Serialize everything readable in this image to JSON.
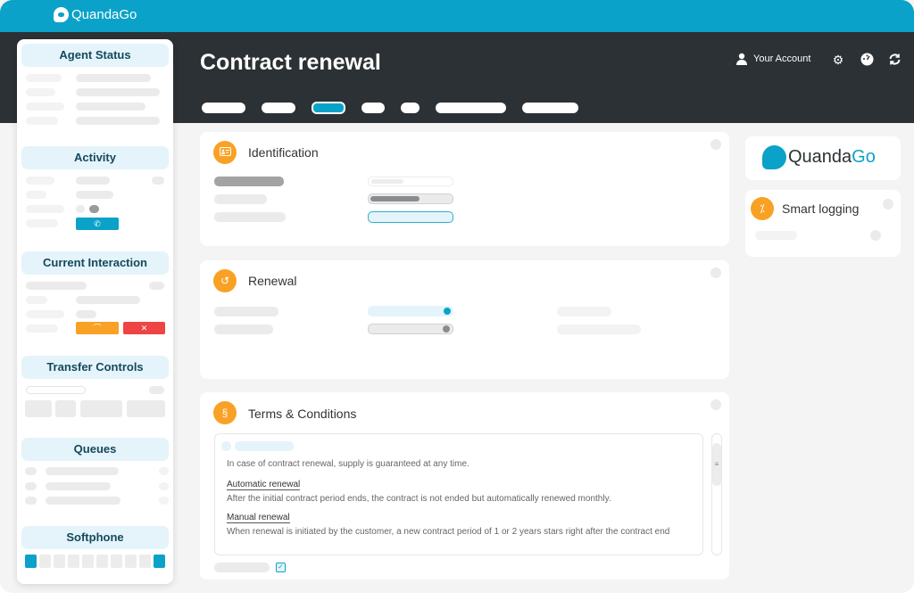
{
  "app": {
    "brand": "QuandaGo",
    "brand_part1": "Quanda",
    "brand_part2": "Go"
  },
  "header": {
    "title": "Contract renewal",
    "account_label": "Your Account",
    "tabs_count": 7,
    "active_tab_index": 2
  },
  "icons": {
    "account": "user-icon",
    "settings": "gear-icon",
    "dashboard": "gauge-icon",
    "refresh": "refresh-icon"
  },
  "sidebar": {
    "sections": [
      "Agent Status",
      "Activity",
      "Current Interaction",
      "Transfer Controls",
      "Queues",
      "Softphone"
    ],
    "activity_button_icon": "phone-plus-icon",
    "interaction_buttons": [
      "hold-icon",
      "hangup-icon"
    ]
  },
  "cards": {
    "identification": {
      "title": "Identification",
      "icon": "id-card-icon"
    },
    "renewal": {
      "title": "Renewal",
      "icon": "undo-icon"
    },
    "terms": {
      "title": "Terms & Conditions",
      "icon": "section-icon",
      "intro": "In case of contract renewal, supply is guaranteed at any time.",
      "items": [
        {
          "heading": "Automatic renewal",
          "text": "After the initial contract period ends, the contract is not ended but automatically renewed monthly."
        },
        {
          "heading": "Manual renewal",
          "text": "When renewal is initiated by the customer, a new contract period of 1 or 2 years stars right after the contract end"
        }
      ],
      "checkbox_checked": true
    },
    "smart_logging": {
      "title": "Smart logging",
      "icon": "magic-wand-icon"
    }
  },
  "colors": {
    "accent": "#0aa2c8",
    "dark": "#2b3134",
    "orange": "#f9a124",
    "red": "#ef4444"
  }
}
